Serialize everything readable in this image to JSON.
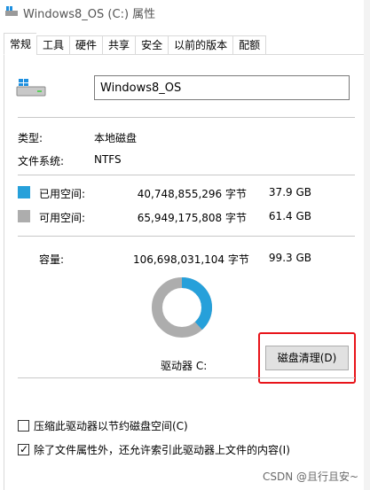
{
  "window": {
    "title": "Windows8_OS (C:) 属性",
    "icon": "drive-icon"
  },
  "tabs": [
    {
      "label": "常规",
      "active": true
    },
    {
      "label": "工具",
      "active": false
    },
    {
      "label": "硬件",
      "active": false
    },
    {
      "label": "共享",
      "active": false
    },
    {
      "label": "安全",
      "active": false
    },
    {
      "label": "以前的版本",
      "active": false
    },
    {
      "label": "配额",
      "active": false
    }
  ],
  "general": {
    "drive_name": "Windows8_OS",
    "type_label": "类型:",
    "type_value": "本地磁盘",
    "fs_label": "文件系统:",
    "fs_value": "NTFS",
    "used": {
      "label": "已用空间:",
      "bytes": "40,748,855,296 字节",
      "size": "37.9 GB",
      "color": "#26a0da"
    },
    "free": {
      "label": "可用空间:",
      "bytes": "65,949,175,808 字节",
      "size": "61.4 GB",
      "color": "#adadad"
    },
    "capacity": {
      "label": "容量:",
      "bytes": "106,698,031,104 字节",
      "size": "99.3 GB"
    },
    "used_fraction": 0.382,
    "drive_label": "驱动器 C:",
    "cleanup_button": "磁盘清理(D)",
    "highlight_color": "#e8141a"
  },
  "options": {
    "compress_label": "压缩此驱动器以节约磁盘空间(C)",
    "compress_checked": false,
    "index_label": "除了文件属性外，还允许索引此驱动器上文件的内容(I)",
    "index_checked": true
  },
  "watermark": "CSDN @且行且安~"
}
